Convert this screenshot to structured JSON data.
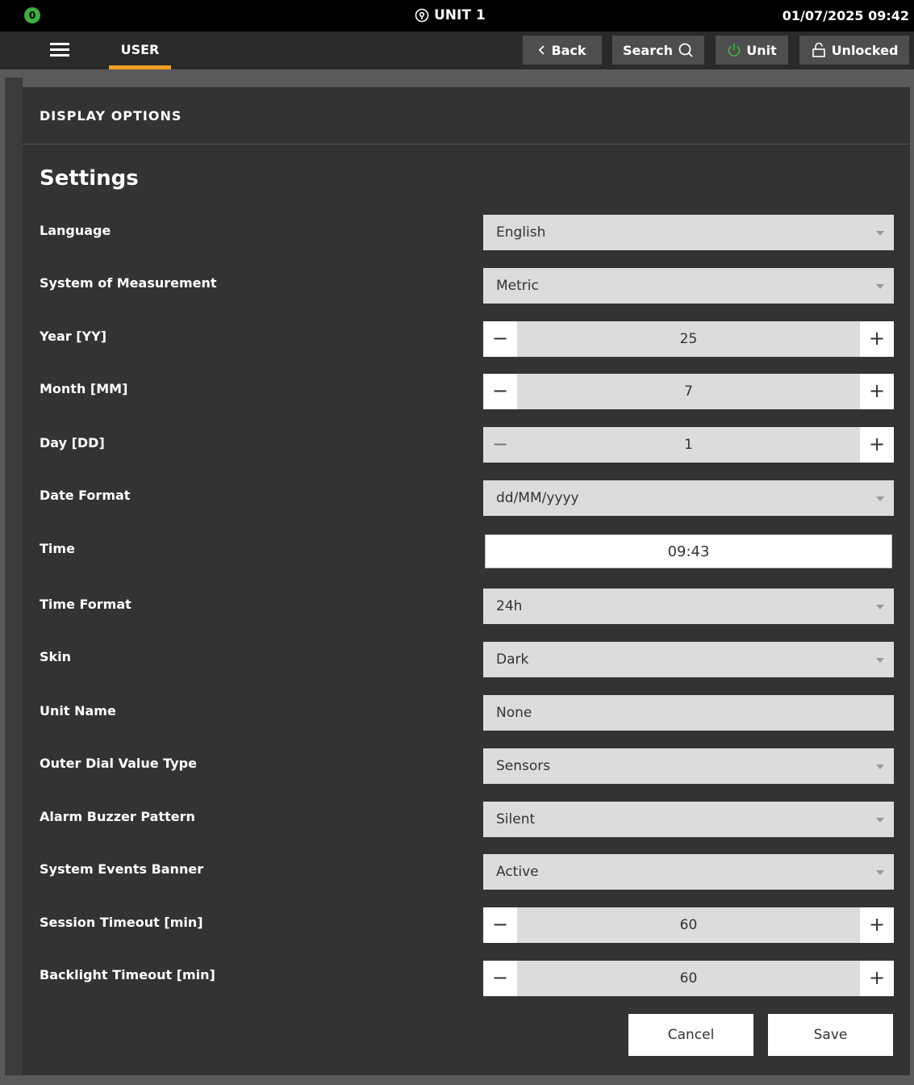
{
  "status": {
    "badge": "0",
    "unit": "UNIT 1",
    "datetime": "01/07/2025 09:42"
  },
  "nav": {
    "tab": "USER",
    "back": "Back",
    "search": "Search",
    "unit": "Unit",
    "lock": "Unlocked"
  },
  "panel": {
    "header": "DISPLAY OPTIONS",
    "title": "Settings"
  },
  "fields": {
    "language": {
      "label": "Language",
      "value": "English"
    },
    "measurement": {
      "label": "System of Measurement",
      "value": "Metric"
    },
    "year": {
      "label": "Year [YY]",
      "value": "25"
    },
    "month": {
      "label": "Month [MM]",
      "value": "7"
    },
    "day": {
      "label": "Day [DD]",
      "value": "1"
    },
    "date_format": {
      "label": "Date Format",
      "value": "dd/MM/yyyy"
    },
    "time": {
      "label": "Time",
      "value": "09:43"
    },
    "time_format": {
      "label": "Time Format",
      "value": "24h"
    },
    "skin": {
      "label": "Skin",
      "value": "Dark"
    },
    "unit_name": {
      "label": "Unit Name",
      "value": "None"
    },
    "outer_dial": {
      "label": "Outer Dial Value Type",
      "value": "Sensors"
    },
    "alarm_buzzer": {
      "label": "Alarm Buzzer Pattern",
      "value": "Silent"
    },
    "events_banner": {
      "label": "System Events Banner",
      "value": "Active"
    },
    "session_timeout": {
      "label": "Session Timeout [min]",
      "value": "60"
    },
    "backlight_timeout": {
      "label": "Backlight Timeout [min]",
      "value": "60"
    }
  },
  "stepper_symbols": {
    "minus": "−",
    "plus": "+"
  },
  "actions": {
    "cancel": "Cancel",
    "save": "Save"
  },
  "colors": {
    "accent": "#f0a020",
    "power_green": "#3fae3f",
    "panel_bg": "#333333",
    "field_bg": "#dcdcdc"
  }
}
